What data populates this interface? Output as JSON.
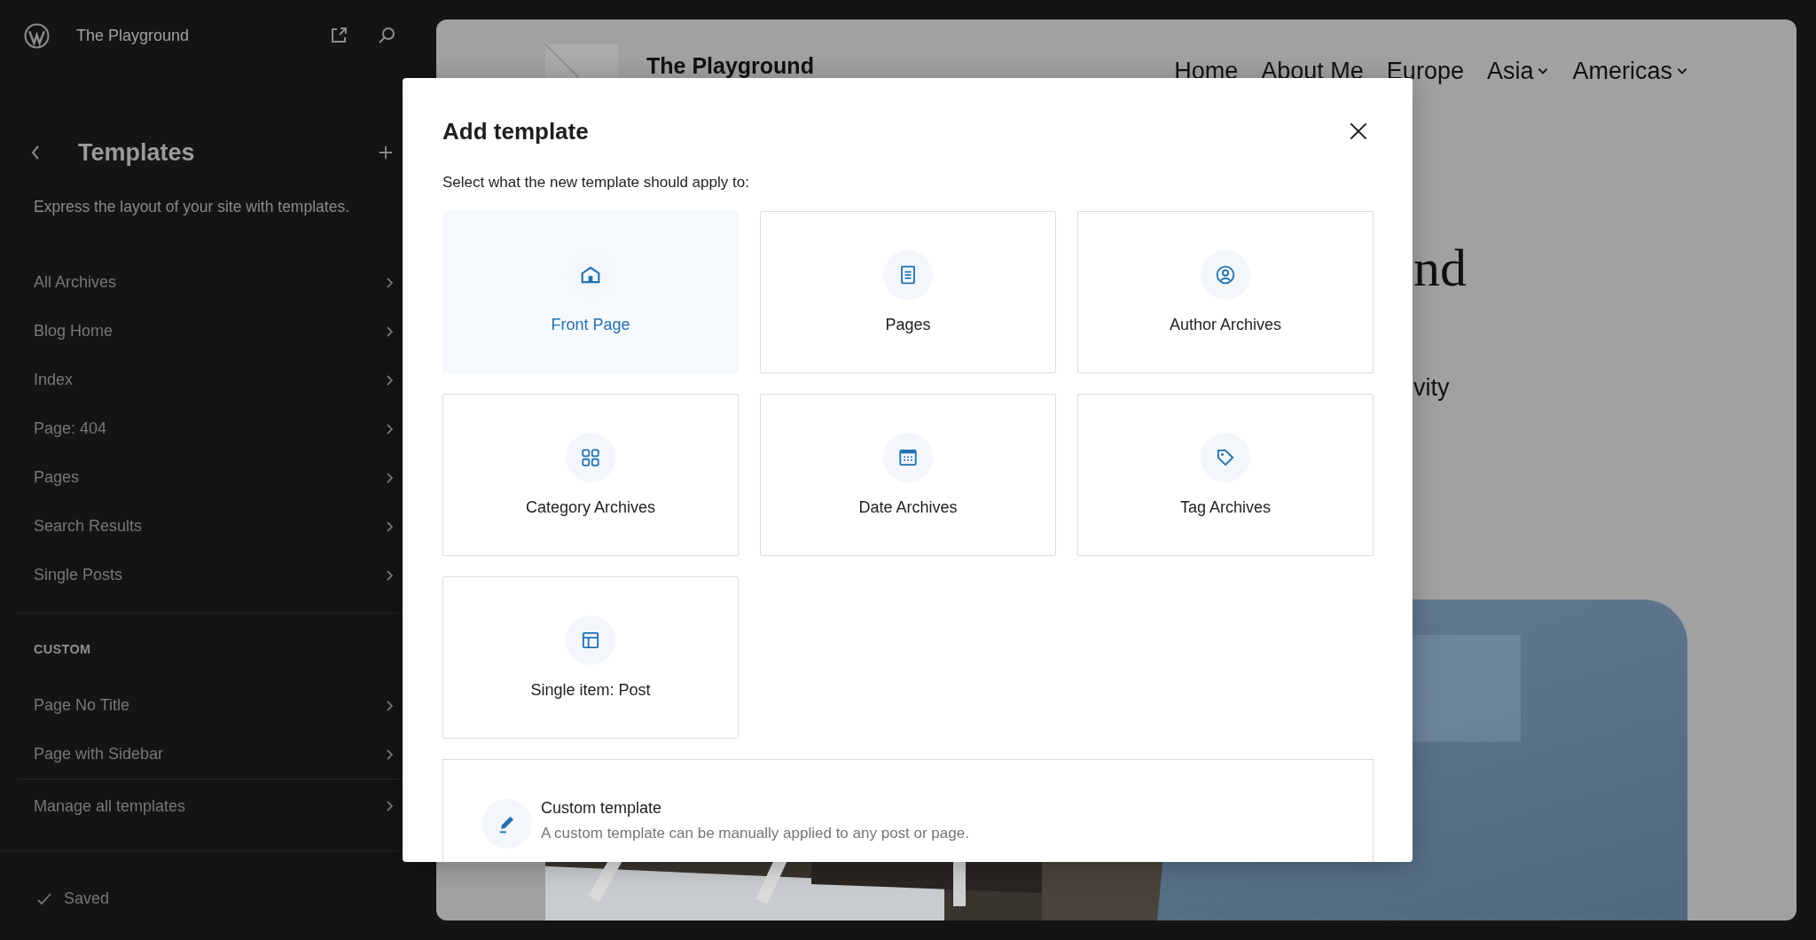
{
  "sidebar": {
    "site_title": "The Playground",
    "section_title": "Templates",
    "description": "Express the layout of your site with templates.",
    "items": [
      {
        "label": "All Archives"
      },
      {
        "label": "Blog Home"
      },
      {
        "label": "Index"
      },
      {
        "label": "Page: 404"
      },
      {
        "label": "Pages"
      },
      {
        "label": "Search Results"
      },
      {
        "label": "Single Posts"
      }
    ],
    "custom_heading": "CUSTOM",
    "custom_items": [
      {
        "label": "Page No Title"
      },
      {
        "label": "Page with Sidebar"
      }
    ],
    "footer_link": "Manage all templates",
    "status": "Saved"
  },
  "preview": {
    "site_title": "The Playground",
    "nav": [
      {
        "label": "Home",
        "has_submenu": false
      },
      {
        "label": "About Me",
        "has_submenu": false
      },
      {
        "label": "Europe",
        "has_submenu": false
      },
      {
        "label": "Asia",
        "has_submenu": true
      },
      {
        "label": "Americas",
        "has_submenu": true
      }
    ],
    "heading_fragment": "nd",
    "text_fragment": "vity"
  },
  "modal": {
    "title": "Add template",
    "subtitle": "Select what the new template should apply to:",
    "options": [
      {
        "label": "Front Page",
        "selected": true
      },
      {
        "label": "Pages",
        "selected": false
      },
      {
        "label": "Author Archives",
        "selected": false
      },
      {
        "label": "Category Archives",
        "selected": false
      },
      {
        "label": "Date Archives",
        "selected": false
      },
      {
        "label": "Tag Archives",
        "selected": false
      },
      {
        "label": "Single item: Post",
        "selected": false
      }
    ],
    "custom": {
      "title": "Custom template",
      "description": "A custom template can be manually applied to any post or page."
    }
  }
}
